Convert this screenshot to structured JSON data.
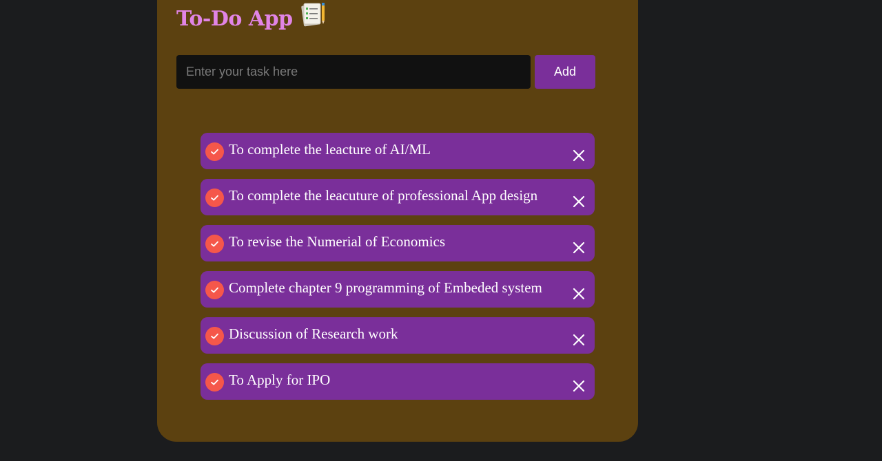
{
  "app": {
    "title": "To-Do App",
    "title_icon": "notepad-checklist-icon"
  },
  "input": {
    "placeholder": "Enter your task here",
    "value": ""
  },
  "add_button": {
    "label": "Add"
  },
  "tasks": [
    {
      "text": "To complete the leacture of AI/ML",
      "checked": true
    },
    {
      "text": "To complete the leacuture of professional App design",
      "checked": true
    },
    {
      "text": "To revise the Numerial of Economics",
      "checked": true
    },
    {
      "text": "Complete chapter 9 programming of Embeded system",
      "checked": true
    },
    {
      "text": "Discussion of Research work",
      "checked": true
    },
    {
      "text": "To Apply for IPO",
      "checked": true
    }
  ],
  "icons": {
    "check": "check-circle-icon",
    "remove": "close-icon"
  },
  "colors": {
    "page_background": "#1b1c1e",
    "card_background": "#5c4110",
    "title": "#e184e6",
    "accent": "#7a2f9a",
    "check_circle": "#f5574a",
    "input_background": "#111111"
  }
}
